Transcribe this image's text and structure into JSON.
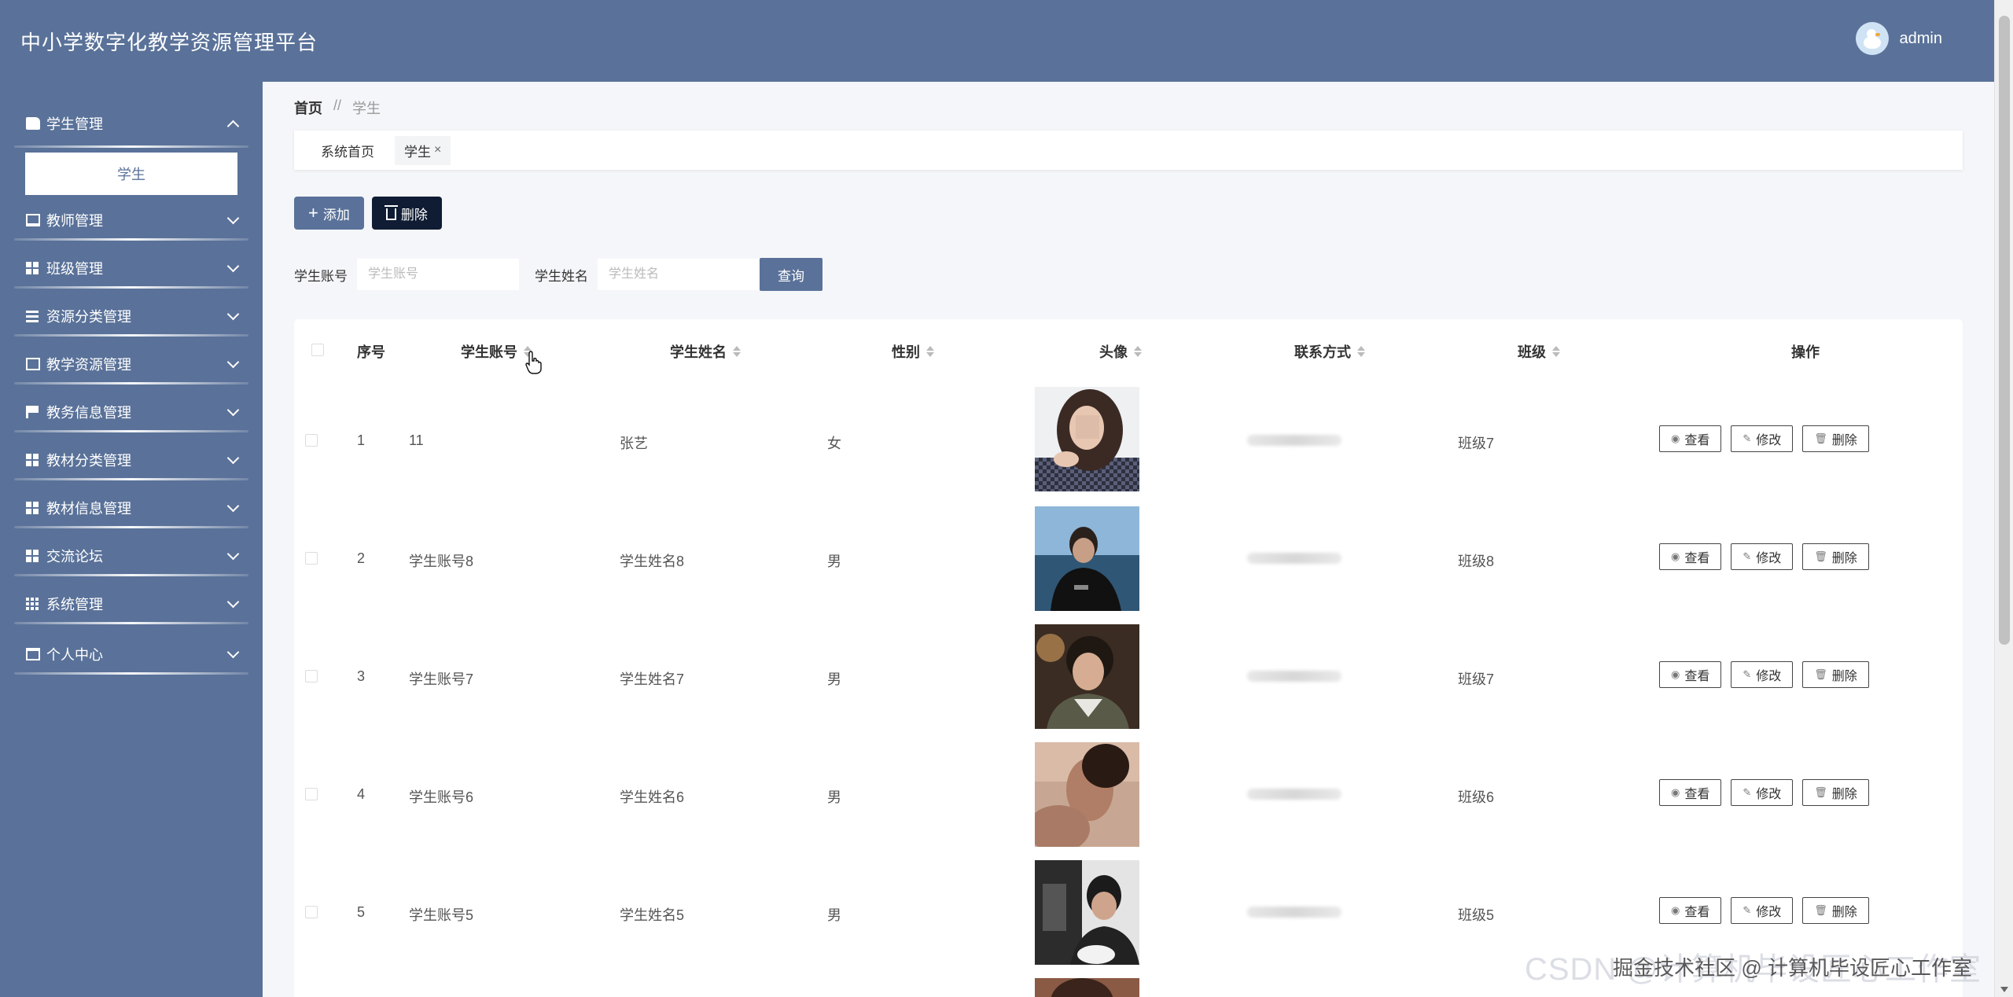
{
  "app": {
    "title": "中小学数字化教学资源管理平台"
  },
  "user": {
    "name": "admin"
  },
  "sidebar": {
    "groups": [
      {
        "label": "学生管理",
        "icon": "users-icon",
        "expanded": true,
        "children": [
          "学生"
        ]
      },
      {
        "label": "教师管理",
        "icon": "monitor-icon"
      },
      {
        "label": "班级管理",
        "icon": "grid-icon"
      },
      {
        "label": "资源分类管理",
        "icon": "list-icon"
      },
      {
        "label": "教学资源管理",
        "icon": "chart-icon"
      },
      {
        "label": "教务信息管理",
        "icon": "flag-icon"
      },
      {
        "label": "教材分类管理",
        "icon": "grid-icon"
      },
      {
        "label": "教材信息管理",
        "icon": "grid-icon"
      },
      {
        "label": "交流论坛",
        "icon": "grid-icon"
      },
      {
        "label": "系统管理",
        "icon": "table-icon"
      },
      {
        "label": "个人中心",
        "icon": "card-icon"
      }
    ]
  },
  "breadcrumb": {
    "home": "首页",
    "sep": "//",
    "current": "学生"
  },
  "tags": {
    "home": "系统首页",
    "current": "学生",
    "close": "×"
  },
  "toolbar": {
    "add_label": "添加",
    "delete_label": "删除"
  },
  "search": {
    "account_label": "学生账号",
    "account_placeholder": "学生账号",
    "name_label": "学生姓名",
    "name_placeholder": "学生姓名",
    "query_label": "查询"
  },
  "table": {
    "columns": {
      "index": "序号",
      "account": "学生账号",
      "name": "学生姓名",
      "gender": "性别",
      "avatar": "头像",
      "contact": "联系方式",
      "class": "班级",
      "actions": "操作"
    },
    "rows": [
      {
        "index": "1",
        "account": "11",
        "name": "张艺",
        "gender": "女",
        "class": "班级7"
      },
      {
        "index": "2",
        "account": "学生账号8",
        "name": "学生姓名8",
        "gender": "男",
        "class": "班级8"
      },
      {
        "index": "3",
        "account": "学生账号7",
        "name": "学生姓名7",
        "gender": "男",
        "class": "班级7"
      },
      {
        "index": "4",
        "account": "学生账号6",
        "name": "学生姓名6",
        "gender": "男",
        "class": "班级6"
      },
      {
        "index": "5",
        "account": "学生账号5",
        "name": "学生姓名5",
        "gender": "男",
        "class": "班级5"
      }
    ],
    "actions": {
      "view": "查看",
      "edit": "修改",
      "delete": "删除"
    }
  },
  "watermark": {
    "text": "CSDN @计算机毕设匠心工作室",
    "sub": "掘金技术社区 @ 计算机毕设匠心工作室"
  },
  "colors": {
    "primary": "#5a7299",
    "dark_button": "#0f1c33"
  }
}
